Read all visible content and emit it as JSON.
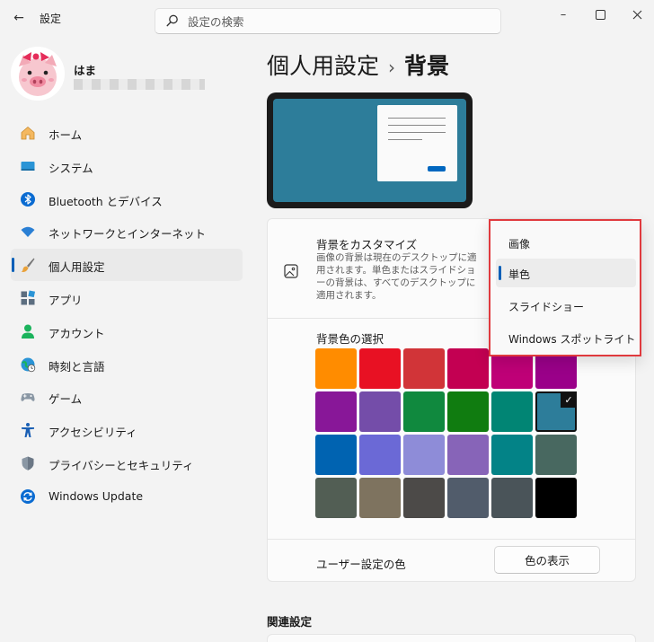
{
  "app": {
    "title": "設定",
    "back_glyph": "←"
  },
  "search": {
    "placeholder": "設定の検索"
  },
  "window_controls": {
    "minimize": "–",
    "maximize": "☐",
    "close": "✕"
  },
  "user": {
    "name": "はま"
  },
  "sidebar": {
    "items": [
      {
        "label": "ホーム",
        "icon": "home-icon"
      },
      {
        "label": "システム",
        "icon": "system-icon"
      },
      {
        "label": "Bluetooth とデバイス",
        "icon": "bluetooth-icon"
      },
      {
        "label": "ネットワークとインターネット",
        "icon": "wifi-icon"
      },
      {
        "label": "個人用設定",
        "icon": "brush-icon",
        "active": true
      },
      {
        "label": "アプリ",
        "icon": "apps-icon"
      },
      {
        "label": "アカウント",
        "icon": "account-icon"
      },
      {
        "label": "時刻と言語",
        "icon": "globe-clock-icon"
      },
      {
        "label": "ゲーム",
        "icon": "gamepad-icon"
      },
      {
        "label": "アクセシビリティ",
        "icon": "accessibility-icon"
      },
      {
        "label": "プライバシーとセキュリティ",
        "icon": "shield-icon"
      },
      {
        "label": "Windows Update",
        "icon": "update-icon"
      }
    ]
  },
  "main": {
    "breadcrumb": {
      "parent": "個人用設定",
      "separator": "›",
      "current": "背景"
    },
    "customize": {
      "title": "背景をカスタマイズ",
      "description": "画像の背景は現在のデスクトップに適用されます。単色またはスライドショーの背景は、すべてのデスクトップに適用されます。",
      "icon": "image-icon"
    },
    "colors": {
      "title": "背景色の選択",
      "selected_index": 11,
      "check_glyph": "✓",
      "swatches": [
        "#ff8c00",
        "#e81123",
        "#d13438",
        "#c30052",
        "#bf0077",
        "#9a0089",
        "#881798",
        "#744da9",
        "#10893e",
        "#107c10",
        "#018574",
        "#2d7d9a",
        "#0063b1",
        "#6b69d6",
        "#8e8cd8",
        "#8764b8",
        "#038387",
        "#486860",
        "#525e54",
        "#7e735f",
        "#4c4a48",
        "#515c6b",
        "#4a5459",
        "#000000"
      ]
    },
    "custom_color": {
      "label": "ユーザー設定の色",
      "button": "色の表示"
    },
    "related": {
      "title": "関連設定"
    }
  },
  "dropdown": {
    "items": [
      "画像",
      "単色",
      "スライドショー",
      "Windows スポットライト"
    ],
    "selected": 1,
    "highlight_color": "#e03a3e"
  },
  "colors": {
    "accent": "#005fb8",
    "preview_bg": "#2d7d9a"
  }
}
